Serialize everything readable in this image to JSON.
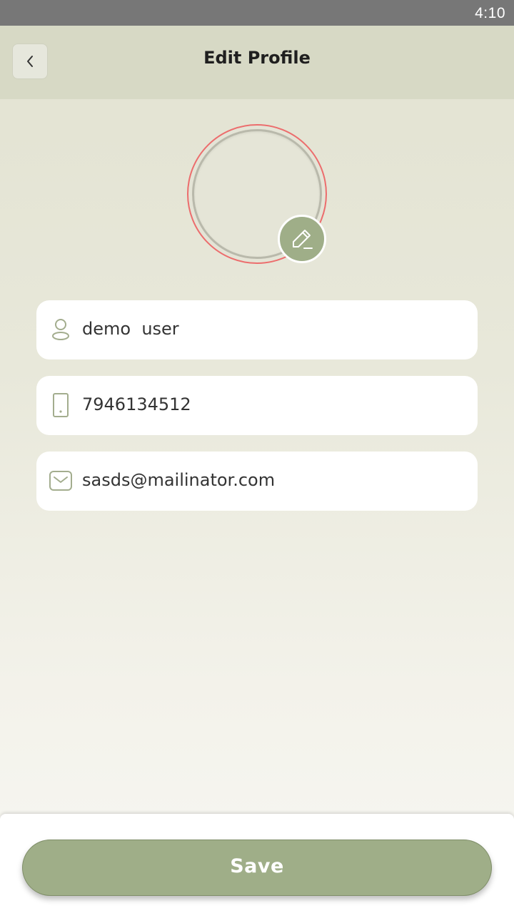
{
  "status_bar": {
    "time": "4:10"
  },
  "header": {
    "title": "Edit Profile",
    "back_icon": "chevron-left-icon"
  },
  "avatar": {
    "edit_icon": "pencil-icon",
    "ring_color": "#ec6d6d"
  },
  "form": {
    "fields": [
      {
        "icon": "user-icon",
        "value": "demo  user"
      },
      {
        "icon": "phone-icon",
        "value": "7946134512"
      },
      {
        "icon": "mail-icon",
        "value": "sasds@mailinator.com"
      }
    ]
  },
  "footer": {
    "save_label": "Save"
  },
  "colors": {
    "accent": "#9fae88",
    "header_bg": "#d7d9c5",
    "status_bar_bg": "#777777"
  }
}
